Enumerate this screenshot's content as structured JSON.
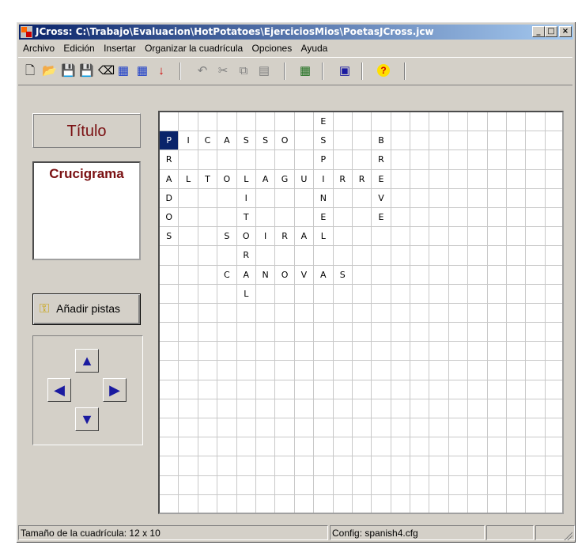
{
  "window": {
    "title": "JCross: C:\\Trabajo\\Evaluacion\\HotPotatoes\\EjerciciosMios\\PoetasJCross.jcw"
  },
  "menu": [
    "Archivo",
    "Edición",
    "Insertar",
    "Organizar la cuadrícula",
    "Opciones",
    "Ayuda"
  ],
  "toolbar": {
    "icons": [
      "new-icon",
      "open-icon",
      "save-icon",
      "save-as-icon",
      "eraser-icon",
      "create-web-page-icon",
      "create-web-page-alt-icon",
      "export-icon",
      "undo-icon",
      "cut-icon",
      "copy-icon",
      "paste-icon",
      "auto-grid-icon",
      "config-icon",
      "help-icon"
    ]
  },
  "left_panel": {
    "title": "Título",
    "description": "Crucigrama",
    "add_clues_label": "Añadir pistas"
  },
  "grid": {
    "columns": 21,
    "rows": 21,
    "selected": [
      1,
      0
    ],
    "rows_data": [
      [
        "",
        "",
        "",
        "",
        "",
        "",
        "",
        "",
        "E",
        "",
        "",
        "",
        "",
        "",
        "",
        "",
        "",
        "",
        "",
        "",
        ""
      ],
      [
        "P",
        "I",
        "C",
        "A",
        "S",
        "S",
        "O",
        "",
        "S",
        "",
        "",
        "B",
        "",
        "",
        "",
        "",
        "",
        "",
        "",
        "",
        ""
      ],
      [
        "R",
        "",
        "",
        "",
        "",
        "",
        "",
        "",
        "P",
        "",
        "",
        "R",
        "",
        "",
        "",
        "",
        "",
        "",
        "",
        "",
        ""
      ],
      [
        "A",
        "L",
        "T",
        "O",
        "L",
        "A",
        "G",
        "U",
        "I",
        "R",
        "R",
        "E",
        "",
        "",
        "",
        "",
        "",
        "",
        "",
        "",
        ""
      ],
      [
        "D",
        "",
        "",
        "",
        "I",
        "",
        "",
        "",
        "N",
        "",
        "",
        "V",
        "",
        "",
        "",
        "",
        "",
        "",
        "",
        "",
        ""
      ],
      [
        "O",
        "",
        "",
        "",
        "T",
        "",
        "",
        "",
        "E",
        "",
        "",
        "E",
        "",
        "",
        "",
        "",
        "",
        "",
        "",
        "",
        ""
      ],
      [
        "S",
        "",
        "",
        "S",
        "O",
        "I",
        "R",
        "A",
        "L",
        "",
        "",
        "",
        "",
        "",
        "",
        "",
        "",
        "",
        "",
        "",
        ""
      ],
      [
        "",
        "",
        "",
        "",
        "R",
        "",
        "",
        "",
        "",
        "",
        "",
        "",
        "",
        "",
        "",
        "",
        "",
        "",
        "",
        "",
        ""
      ],
      [
        "",
        "",
        "",
        "C",
        "A",
        "N",
        "O",
        "V",
        "A",
        "S",
        "",
        "",
        "",
        "",
        "",
        "",
        "",
        "",
        "",
        "",
        ""
      ],
      [
        "",
        "",
        "",
        "",
        "L",
        "",
        "",
        "",
        "",
        "",
        "",
        "",
        "",
        "",
        "",
        "",
        "",
        "",
        "",
        "",
        ""
      ]
    ]
  },
  "status": {
    "grid_size": "Tamaño de la cuadrícula: 12 x 10",
    "config": "Config: spanish4.cfg"
  }
}
